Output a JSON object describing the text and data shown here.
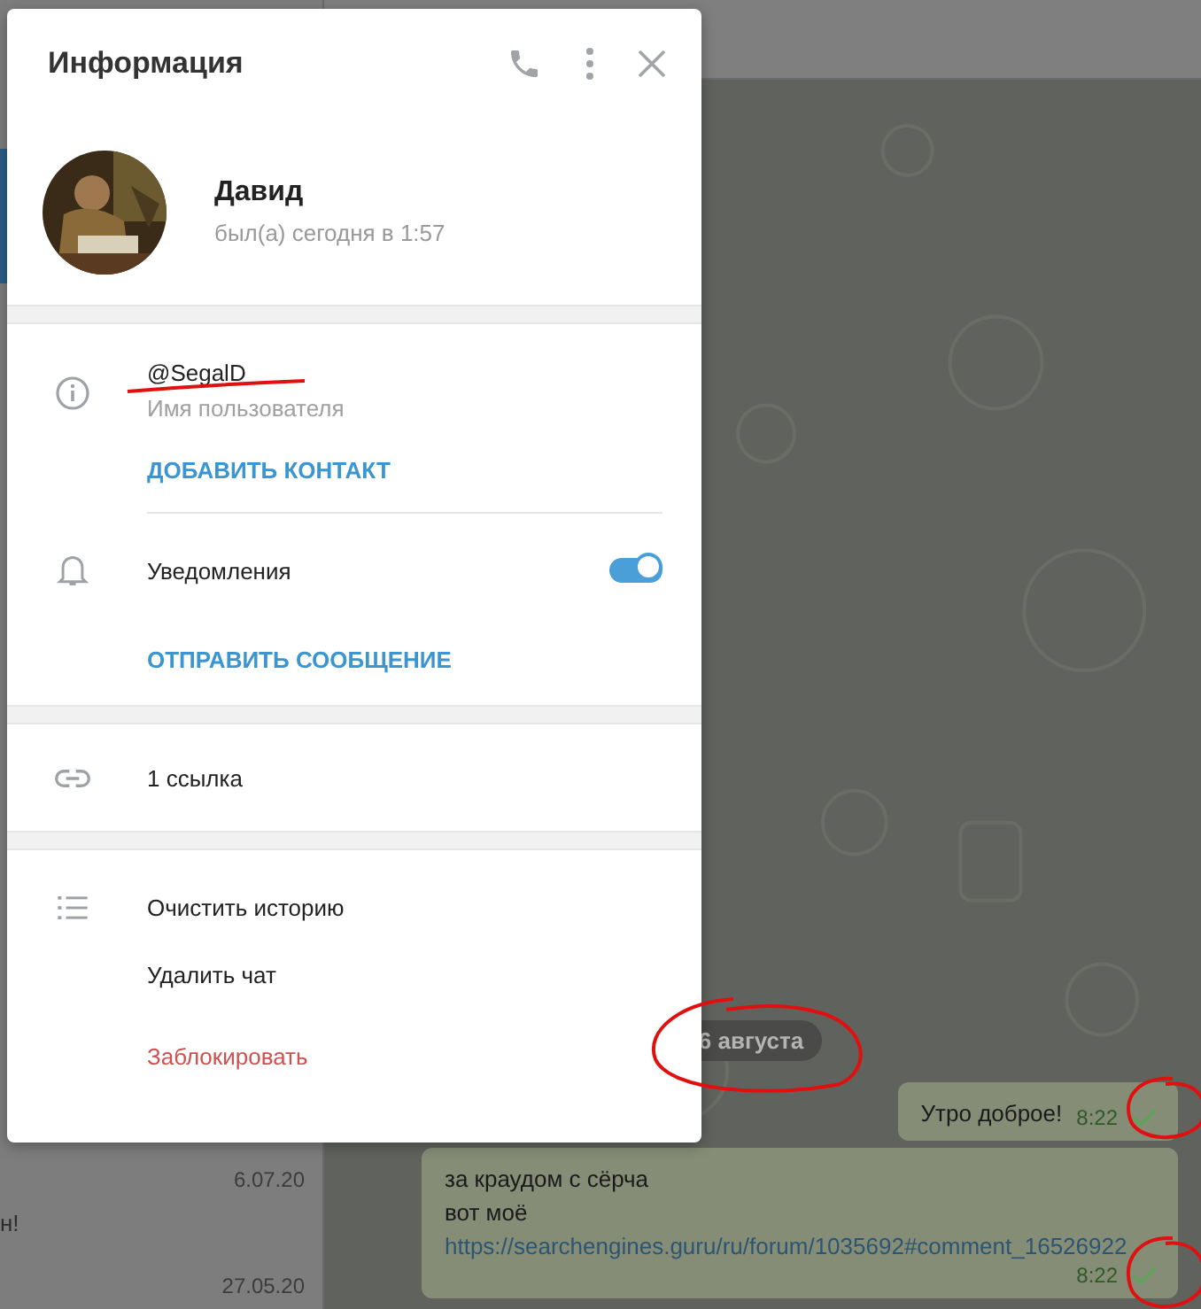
{
  "sidebar": {
    "items": [
      {
        "date": "6.07.20",
        "preview": "н!"
      },
      {
        "date": "27.05.20"
      }
    ]
  },
  "chat": {
    "date_badge": "6 августа",
    "messages": [
      {
        "lines": [
          "Утро доброе!"
        ],
        "time": "8:22",
        "read": false
      },
      {
        "lines": [
          "за краудом с сёрча",
          "вот моё"
        ],
        "link": "https://searchengines.guru/ru/forum/1035692#comment_16526922",
        "time": "8:22",
        "read": false
      }
    ]
  },
  "dialog": {
    "title": "Информация",
    "profile": {
      "name": "Давид",
      "status": "был(а) сегодня в 1:57"
    },
    "info": {
      "username": "@SegalD",
      "username_label": "Имя пользователя",
      "add_contact": "ДОБАВИТЬ КОНТАКТ",
      "notifications": {
        "label": "Уведомления",
        "on": true
      },
      "send_message": "ОТПРАВИТЬ СООБЩЕНИЕ"
    },
    "links": {
      "label": "1 ссылка"
    },
    "actions": [
      {
        "label": "Очистить историю",
        "kind": "normal"
      },
      {
        "label": "Удалить чат",
        "kind": "normal"
      },
      {
        "label": "Заблокировать",
        "kind": "danger"
      }
    ]
  }
}
